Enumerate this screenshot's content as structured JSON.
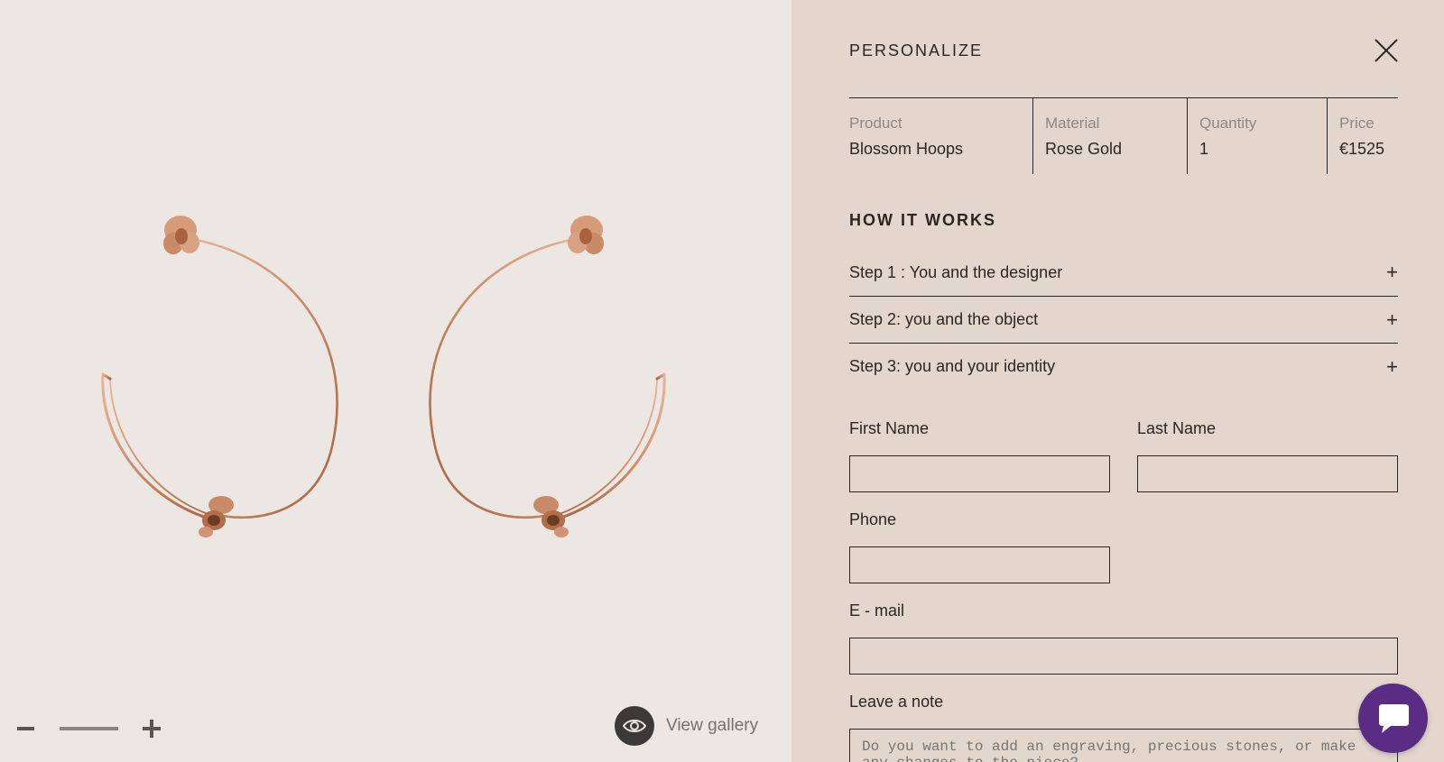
{
  "gallery": {
    "view_label": "View gallery"
  },
  "panel": {
    "title": "PERSONALIZE",
    "summary": [
      {
        "key": "Product",
        "value": "Blossom Hoops"
      },
      {
        "key": "Material",
        "value": "Rose Gold"
      },
      {
        "key": "Quantity",
        "value": "1"
      },
      {
        "key": "Price",
        "value": "€1525"
      }
    ],
    "how_title": "HOW IT WORKS",
    "steps": [
      {
        "label": "Step 1 : You and the designer",
        "toggle": "+"
      },
      {
        "label": "Step 2: you and the object",
        "toggle": "+"
      },
      {
        "label": "Step 3: you and your identity",
        "toggle": "+"
      }
    ]
  },
  "form": {
    "first_name_label": "First Name",
    "last_name_label": "Last Name",
    "phone_label": "Phone",
    "email_label": "E - mail",
    "note_label": "Leave a note",
    "note_placeholder": "Do you want to add an engraving, precious stones, or make any changes to the piece?",
    "first_name_value": "",
    "last_name_value": "",
    "phone_value": "",
    "email_value": ""
  },
  "colors": {
    "left_bg": "#ede7e3",
    "panel_bg": "#e2d6cd",
    "chat_bg": "#5b2c83",
    "rose_gold": "#c98a67"
  },
  "icons": {
    "close": "close-icon",
    "eye": "eye-icon",
    "chat": "chat-icon",
    "zoom_out": "minus-icon",
    "zoom_in": "plus-icon"
  }
}
